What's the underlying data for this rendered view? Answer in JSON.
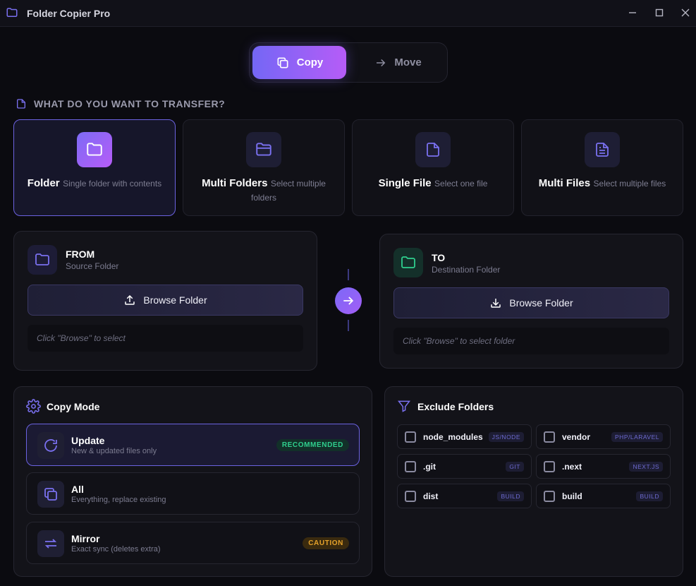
{
  "window": {
    "title": "Folder Copier Pro",
    "minimize": "─",
    "maximize": "☐",
    "close": "✕"
  },
  "mode_toggle": {
    "copy_label": "Copy",
    "move_label": "Move",
    "active": "Copy"
  },
  "transfer_section": {
    "label": "WHAT DO YOU WANT TO TRANSFER?"
  },
  "transfer_types": [
    {
      "name": "Folder",
      "desc": "Single folder with contents",
      "icon": "folder-icon",
      "active": true
    },
    {
      "name": "Multi Folders",
      "desc": "Select multiple folders",
      "icon": "folder-icon",
      "active": false
    },
    {
      "name": "Single File",
      "desc": "Select one file",
      "icon": "file-icon",
      "active": false
    },
    {
      "name": "Multi Files",
      "desc": "Select multiple files",
      "icon": "file-text-icon",
      "active": false
    }
  ],
  "from": {
    "title": "FROM",
    "subtitle": "Source Folder",
    "browse_label": "Browse Folder",
    "path_placeholder": "Click \"Browse\" to select"
  },
  "to": {
    "title": "TO",
    "subtitle": "Destination Folder",
    "browse_label": "Browse Folder",
    "path_placeholder": "Click \"Browse\" to select folder"
  },
  "copy_mode": {
    "title": "Copy Mode",
    "options": [
      {
        "name": "Update",
        "desc": "New & updated files only",
        "badge": "RECOMMENDED",
        "icon": "refresh-icon",
        "active": true
      },
      {
        "name": "All",
        "desc": "Everything, replace existing",
        "badge": "",
        "icon": "copy-icon",
        "active": false
      },
      {
        "name": "Mirror",
        "desc": "Exact sync (deletes extra)",
        "badge": "CAUTION",
        "icon": "sync-icon",
        "active": false
      }
    ]
  },
  "exclude": {
    "title": "Exclude Folders",
    "items": [
      {
        "name": "node_modules",
        "tag": "JS/NODE",
        "checked": false
      },
      {
        "name": "vendor",
        "tag": "PHP/LARAVEL",
        "checked": false
      },
      {
        "name": ".git",
        "tag": "GIT",
        "checked": false
      },
      {
        "name": ".next",
        "tag": "NEXT.JS",
        "checked": false
      },
      {
        "name": "dist",
        "tag": "BUILD",
        "checked": false
      },
      {
        "name": "build",
        "tag": "BUILD",
        "checked": false
      }
    ]
  },
  "colors": {
    "accent": "#7467f5",
    "accent2": "#b65cf7",
    "green": "#2fcf8e",
    "amber": "#e6a22a"
  }
}
